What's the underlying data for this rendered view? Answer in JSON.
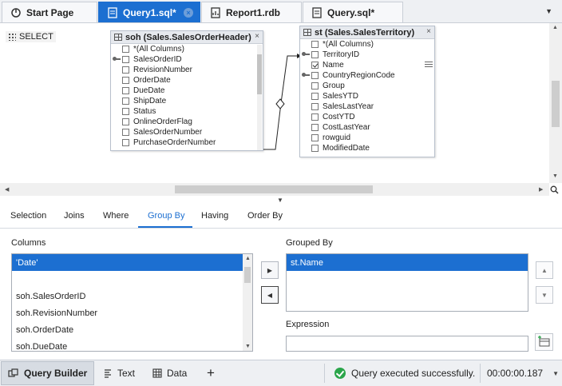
{
  "tabs": [
    {
      "label": "Start Page",
      "icon": "start-page-icon"
    },
    {
      "label": "Query1.sql*",
      "icon": "sql-file-icon",
      "active": true,
      "close": "×"
    },
    {
      "label": "Report1.rdb",
      "icon": "report-icon"
    },
    {
      "label": "Query.sql*",
      "icon": "sql-file-icon"
    }
  ],
  "tab_menu_glyph": "▼",
  "diagram": {
    "select_label": "SELECT",
    "table1": {
      "title": "soh (Sales.SalesOrderHeader)",
      "close": "×",
      "columns": [
        {
          "name": "*(All Columns)",
          "checked": false
        },
        {
          "name": "SalesOrderID",
          "checked": false,
          "key": true
        },
        {
          "name": "RevisionNumber",
          "checked": false
        },
        {
          "name": "OrderDate",
          "checked": false
        },
        {
          "name": "DueDate",
          "checked": false
        },
        {
          "name": "ShipDate",
          "checked": false
        },
        {
          "name": "Status",
          "checked": false
        },
        {
          "name": "OnlineOrderFlag",
          "checked": false
        },
        {
          "name": "SalesOrderNumber",
          "checked": false
        },
        {
          "name": "PurchaseOrderNumber",
          "checked": false
        }
      ]
    },
    "table2": {
      "title": "st (Sales.SalesTerritory)",
      "close": "×",
      "columns": [
        {
          "name": "*(All Columns)",
          "checked": false
        },
        {
          "name": "TerritoryID",
          "checked": false,
          "key": true
        },
        {
          "name": "Name",
          "checked": true
        },
        {
          "name": "CountryRegionCode",
          "checked": false,
          "key": true
        },
        {
          "name": "Group",
          "checked": false
        },
        {
          "name": "SalesYTD",
          "checked": false
        },
        {
          "name": "SalesLastYear",
          "checked": false
        },
        {
          "name": "CostYTD",
          "checked": false
        },
        {
          "name": "CostLastYear",
          "checked": false
        },
        {
          "name": "rowguid",
          "checked": false
        },
        {
          "name": "ModifiedDate",
          "checked": false
        }
      ]
    }
  },
  "clause_tabs": [
    {
      "label": "Selection"
    },
    {
      "label": "Joins"
    },
    {
      "label": "Where"
    },
    {
      "label": "Group By",
      "active": true
    },
    {
      "label": "Having"
    },
    {
      "label": "Order By"
    }
  ],
  "group_by": {
    "columns_label": "Columns",
    "columns": [
      "'Date'",
      "",
      "soh.SalesOrderID",
      "soh.RevisionNumber",
      "soh.OrderDate",
      "soh.DueDate"
    ],
    "selected_column": "'Date'",
    "grouped_by_label": "Grouped By",
    "grouped_by": [
      "st.Name"
    ],
    "expression_label": "Expression",
    "expression_value": "",
    "add_glyph": "▶",
    "remove_glyph": "◀",
    "move_up_glyph": "▲",
    "move_down_glyph": "▼"
  },
  "statusbar": {
    "query_builder": "Query Builder",
    "text": "Text",
    "data": "Data",
    "add": "+",
    "message": "Query executed successfully.",
    "elapsed": "00:00:00.187",
    "elapsed_dropdown": "▼"
  },
  "colors": {
    "accent": "#1c6fd1",
    "success": "#2aa54a"
  }
}
